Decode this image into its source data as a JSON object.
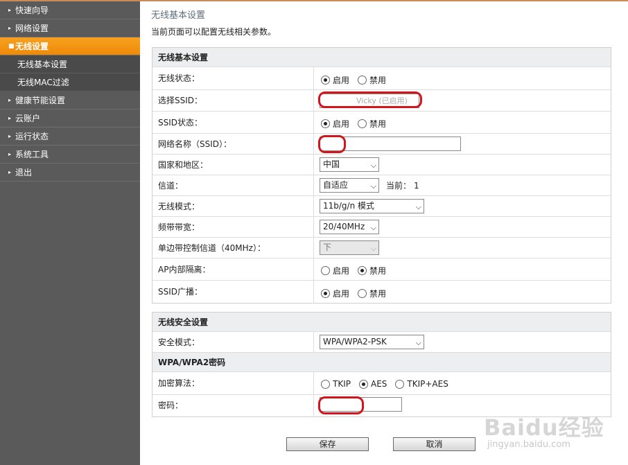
{
  "sidebar": {
    "items": [
      {
        "label": "快速向导"
      },
      {
        "label": "网络设置"
      },
      {
        "label": "无线设置"
      },
      {
        "label": "健康节能设置"
      },
      {
        "label": "云账户"
      },
      {
        "label": "运行状态"
      },
      {
        "label": "系统工具"
      },
      {
        "label": "退出"
      }
    ],
    "subitems": [
      {
        "label": "无线基本设置"
      },
      {
        "label": "无线MAC过滤"
      }
    ],
    "arrow_glyph": "▸"
  },
  "page": {
    "title": "无线基本设置",
    "desc": "当前页面可以配置无线相关参数。"
  },
  "basic": {
    "header": "无线基本设置",
    "wireless_status": {
      "label": "无线状态：",
      "opt1": "启用",
      "opt2": "禁用"
    },
    "select_ssid": {
      "label": "选择SSID：",
      "value": "Vicky (已启用)"
    },
    "ssid_status": {
      "label": "SSID状态：",
      "opt1": "启用",
      "opt2": "禁用"
    },
    "ssid_name": {
      "label": "网络名称（SSID）："
    },
    "country": {
      "label": "国家和地区：",
      "value": "中国"
    },
    "channel": {
      "label": "信道：",
      "value": "自适应",
      "current_label": "当前：",
      "current_value": "1"
    },
    "mode": {
      "label": "无线模式：",
      "value": "11b/g/n 模式"
    },
    "bandwidth": {
      "label": "频带带宽：",
      "value": "20/40MHz"
    },
    "sideband": {
      "label": "单边带控制信道（40MHz）：",
      "value": "下"
    },
    "ap_isolation": {
      "label": "AP内部隔离：",
      "opt1": "启用",
      "opt2": "禁用"
    },
    "ssid_broadcast": {
      "label": "SSID广播：",
      "opt1": "启用",
      "opt2": "禁用"
    }
  },
  "security": {
    "header": "无线安全设置",
    "mode": {
      "label": "安全模式：",
      "value": "WPA/WPA2-PSK"
    },
    "subheader": "WPA/WPA2密码",
    "cipher": {
      "label": "加密算法：",
      "opt1": "TKIP",
      "opt2": "AES",
      "opt3": "TKIP+AES"
    },
    "password": {
      "label": "密码："
    }
  },
  "buttons": {
    "save": "保存",
    "cancel": "取消"
  },
  "watermark": {
    "brand": "Baidu经验",
    "url": "jingyan.baidu.com"
  },
  "colors": {
    "accent": "#f39313",
    "sidebar": "#5a5a5a",
    "annotation": "#d0151b"
  }
}
